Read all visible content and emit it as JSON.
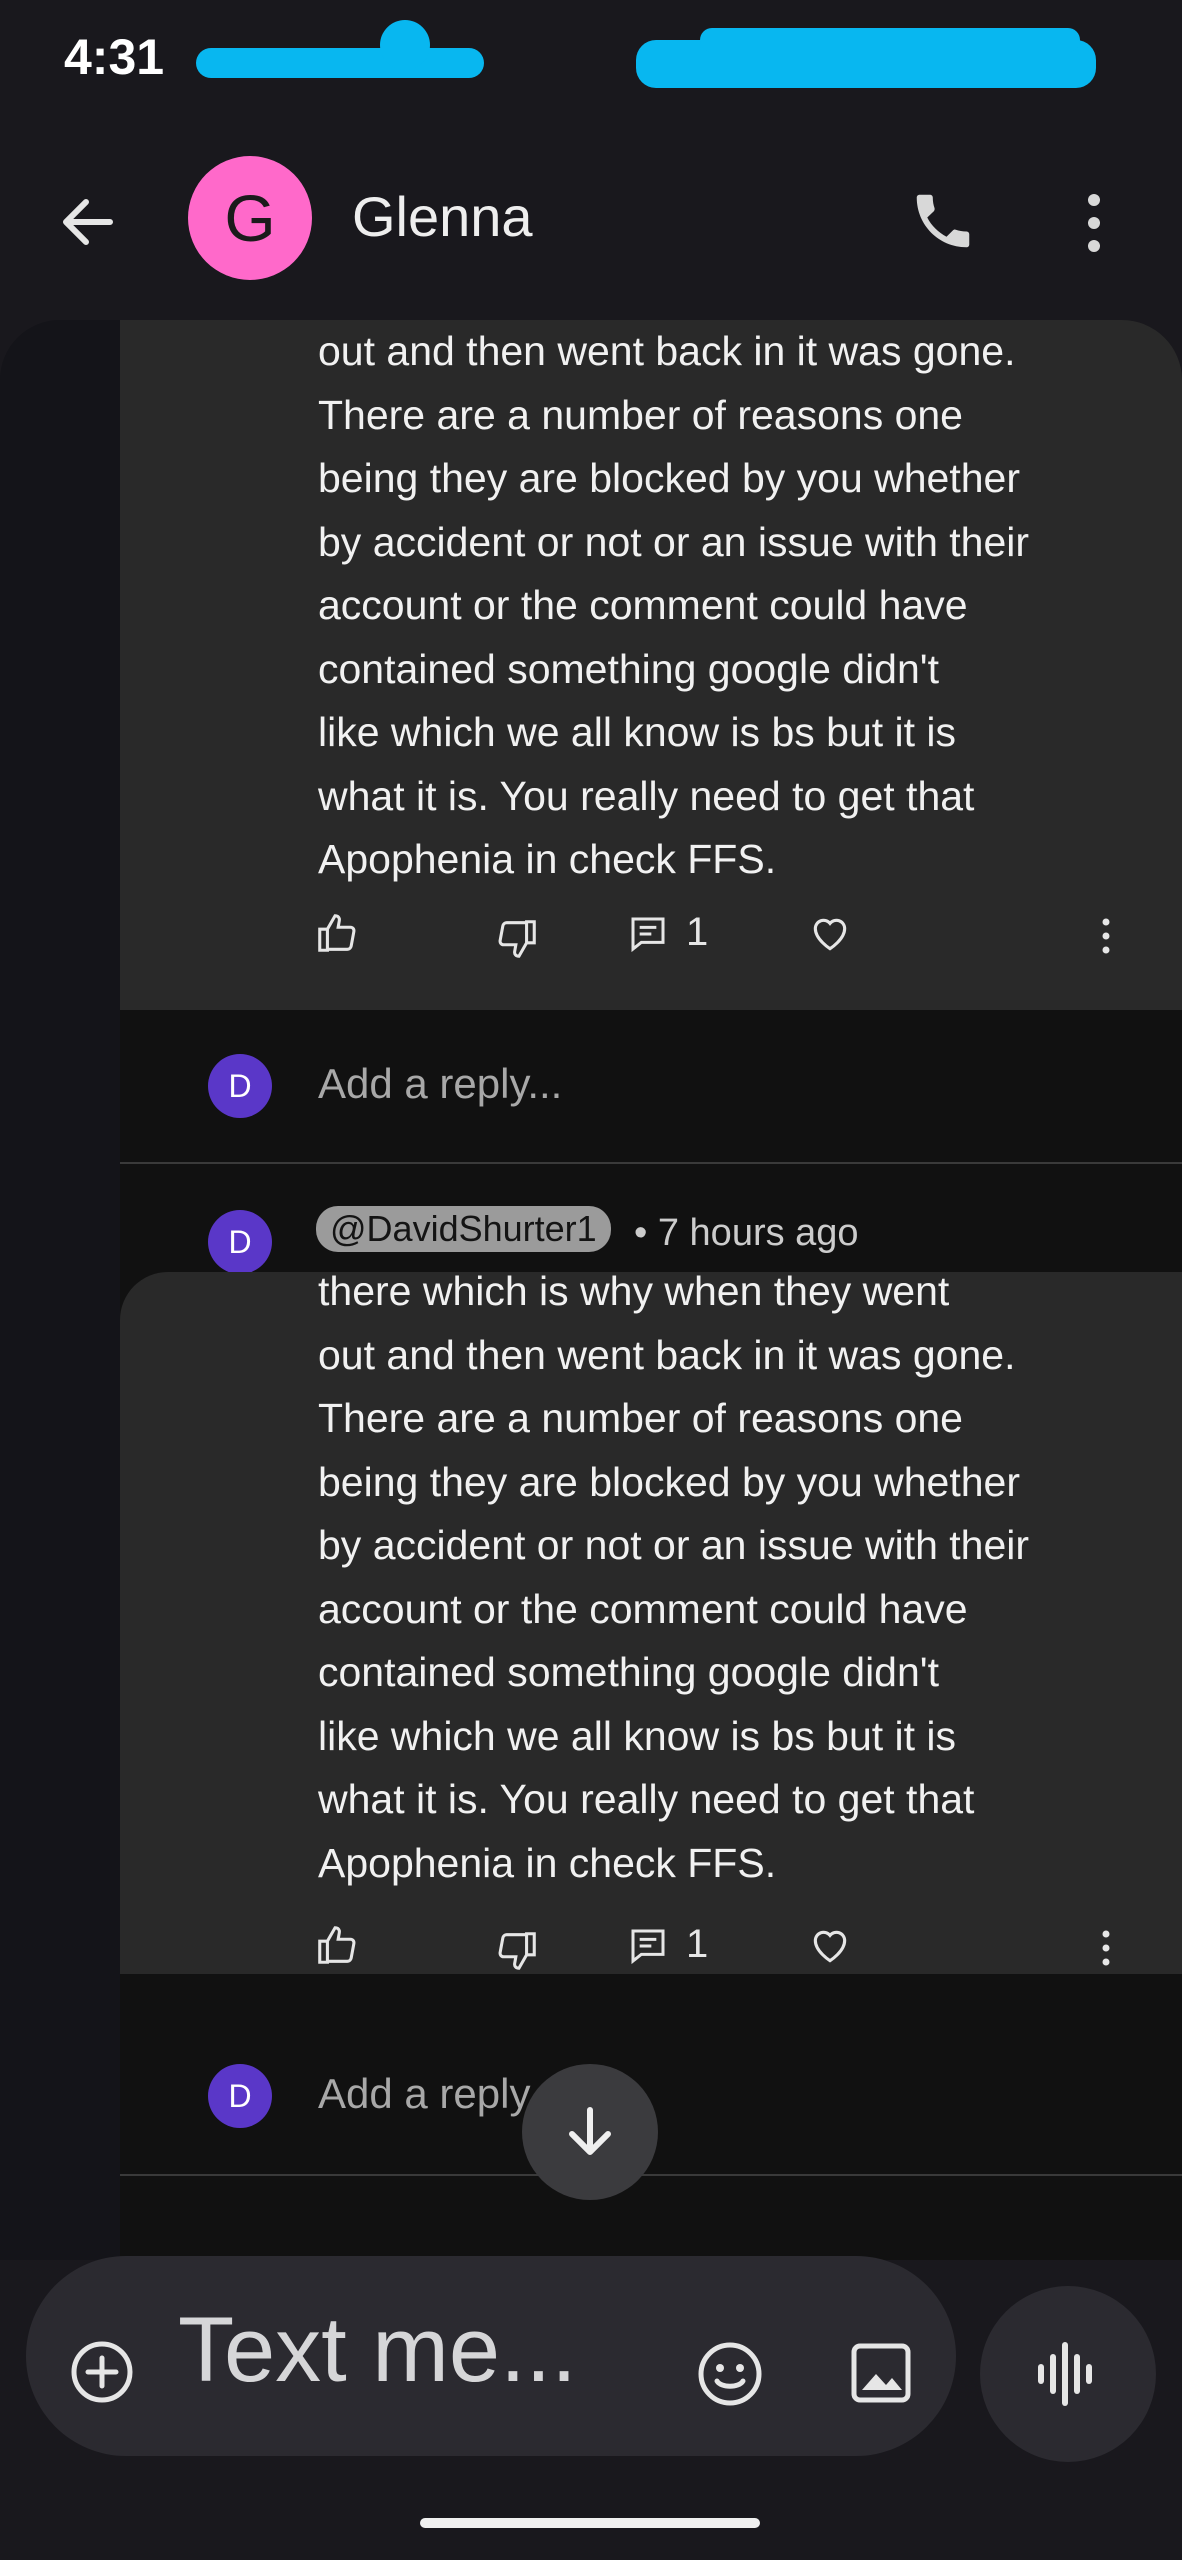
{
  "status_bar": {
    "time": "4:31"
  },
  "header": {
    "contact_initial": "G",
    "contact_name": "Glenna"
  },
  "comment_1": {
    "lines": [
      "out and then went back in it was gone.",
      "There are a number of reasons one",
      "being they are blocked by you whether",
      "by accident or not or an issue with their",
      "account or the comment could have",
      "contained something google didn't",
      "like which we all know is bs but it is",
      "what it is. You really need to get that",
      "Apophenia in check FFS."
    ],
    "reply_count": "1"
  },
  "reply_box_1": {
    "avatar_initial": "D",
    "placeholder": "Add a reply..."
  },
  "comment_2": {
    "avatar_initial": "D",
    "handle": "@DavidShurter1",
    "timestamp": "• 7 hours ago",
    "lines": [
      "there which is why when they went",
      "out and then went back in it was gone.",
      "There are a number of reasons one",
      "being they are blocked by you whether",
      "by accident or not or an issue with their",
      "account or the comment could have",
      "contained something google didn't",
      "like which we all know is bs but it is",
      "what it is. You really need to get that",
      "Apophenia in check FFS."
    ],
    "reply_count": "1"
  },
  "reply_box_2": {
    "avatar_initial": "D",
    "placeholder": "Add a reply"
  },
  "compose": {
    "placeholder": "Text me..."
  },
  "colors": {
    "avatar": "#ff69ca",
    "reply_avatar": "#5a37c8",
    "redaction": "#08b7f0"
  }
}
